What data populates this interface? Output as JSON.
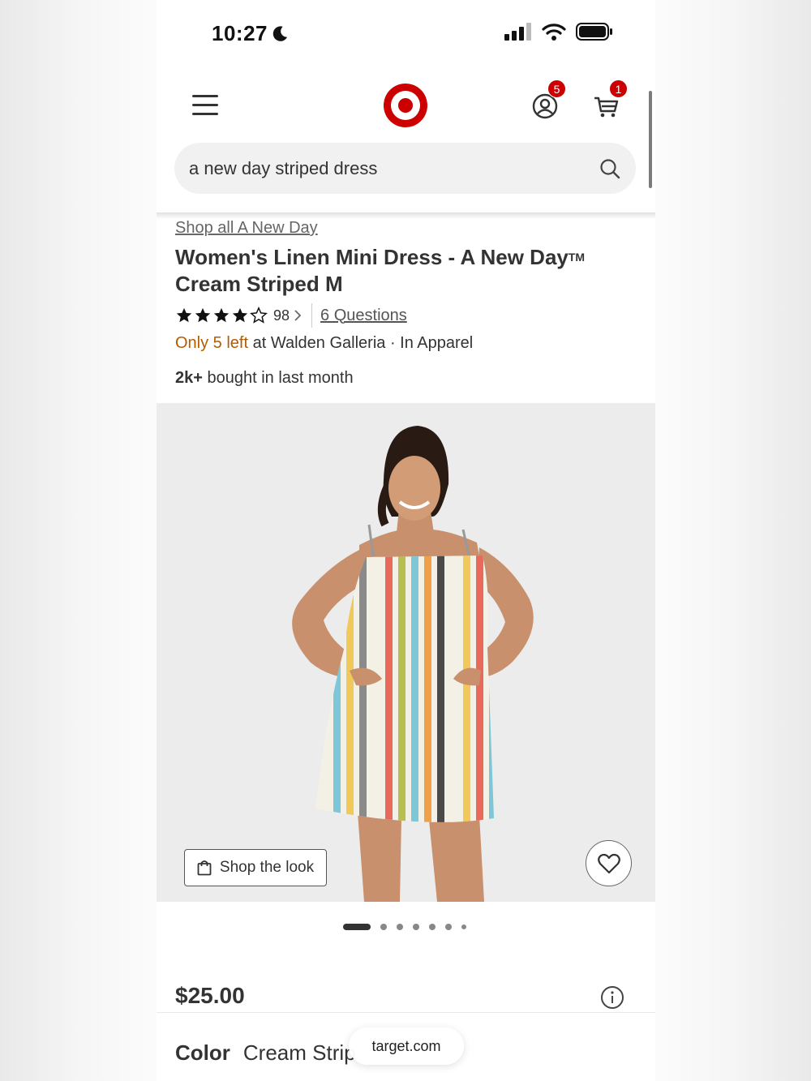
{
  "status_bar": {
    "time": "10:27"
  },
  "header": {
    "account_badge": "5",
    "cart_badge": "1",
    "brand_color": "#cc0000"
  },
  "search": {
    "value": "a new day striped dress",
    "placeholder": ""
  },
  "product": {
    "breadcrumb": "Shop all A New Day",
    "title_main": "Women's Linen Mini Dress - A New Day",
    "title_tm": "TM",
    "title_variant": "Cream Striped M",
    "rating": {
      "stars": 4,
      "out_of": 5,
      "count": "98"
    },
    "questions": "6 Questions",
    "stock": {
      "low_text": "Only 5 left",
      "rest": " at Walden Galleria · In Apparel"
    },
    "bought": {
      "bold": "2k+",
      "rest": " bought in last month"
    },
    "shop_look": "Shop the look",
    "carousel": {
      "total": 8,
      "active": 0
    },
    "price": "$25.00",
    "color_label": "Color",
    "color_value": "Cream Strip"
  },
  "domain_pill": "target.com",
  "icons": [
    "hamburger-icon",
    "target-logo",
    "account-icon",
    "cart-icon",
    "search-icon",
    "star-icon",
    "shopping-bag-icon",
    "heart-icon",
    "info-icon",
    "moon-icon",
    "signal-icon",
    "wifi-icon",
    "battery-icon"
  ]
}
